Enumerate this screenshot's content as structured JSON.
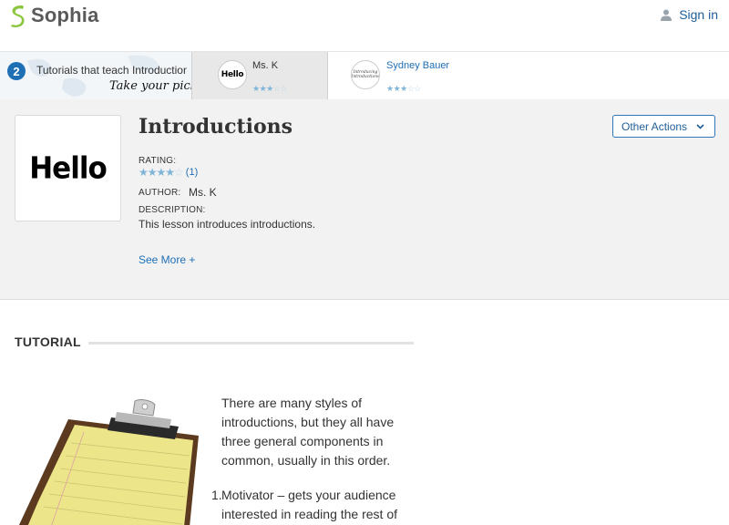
{
  "header": {
    "logo_text": "Sophia",
    "signin_label": "Sign in"
  },
  "strip": {
    "badge_count": "2",
    "title": "Tutorials that teach Introductions",
    "pick_text": "Take your pick:",
    "items": [
      {
        "thumb_text": "Hello",
        "author": "Ms. K",
        "stars_on": "★★★",
        "stars_off": "☆☆"
      },
      {
        "thumb_text": "Introducing Introductions",
        "author": "Sydney Bauer",
        "stars_on": "★★★",
        "stars_off": "☆☆"
      }
    ]
  },
  "lesson": {
    "thumb_text": "Hello",
    "title": "Introductions",
    "other_actions_label": "Other Actions",
    "rating_label": "RATING:",
    "rating_stars_on": "★★★★",
    "rating_stars_off": "☆",
    "rating_count": "(1)",
    "author_label": "AUTHOR:",
    "author": "Ms. K",
    "description_label": "DESCRIPTION:",
    "description": "This lesson introduces introductions.",
    "see_more_label": "See More +"
  },
  "tutorial": {
    "heading": "TUTORIAL",
    "intro_text": "There are many styles of introductions, but they all have three general components in common, usually in this order.",
    "list_number": "1.",
    "list_text": "Motivator – gets your audience interested in reading the rest of the"
  },
  "colors": {
    "brand_green": "#8cc63f",
    "link_blue": "#1f6fb5",
    "star_blue": "#7fb5d8"
  }
}
